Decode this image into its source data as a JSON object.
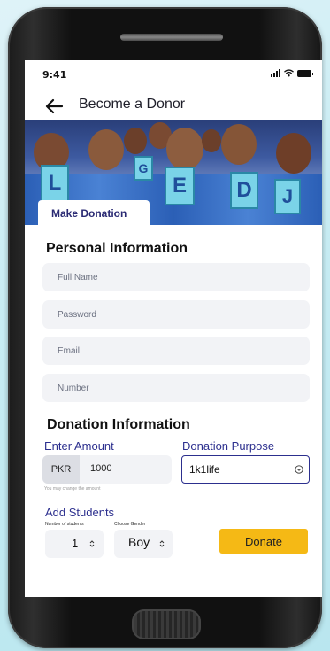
{
  "status_bar": {
    "time": "9:41"
  },
  "header": {
    "title": "Become a Donor"
  },
  "hero": {
    "letters": [
      "L",
      "G",
      "E",
      "D",
      "J"
    ]
  },
  "tabs": {
    "active": "Make Donation"
  },
  "personal": {
    "title": "Personal Information",
    "fields": [
      {
        "placeholder": "Full Name"
      },
      {
        "placeholder": "Password"
      },
      {
        "placeholder": "Email"
      },
      {
        "placeholder": "Number"
      }
    ]
  },
  "donation": {
    "title": "Donation Information",
    "amount_label": "Enter Amount",
    "currency": "PKR",
    "amount": "1000",
    "amount_hint": "You may change the amount",
    "purpose_label": "Donation Purpose",
    "purpose_value": "1k1life"
  },
  "students": {
    "title": "Add Students",
    "count_label": "Number of students",
    "count_value": "1",
    "gender_label": "Choose Gender",
    "gender_value": "Boy"
  },
  "actions": {
    "donate_label": "Donate"
  },
  "colors": {
    "accent_blue": "#2c2f8e",
    "donate_yellow": "#f5b915",
    "field_bg": "#f2f3f6"
  }
}
